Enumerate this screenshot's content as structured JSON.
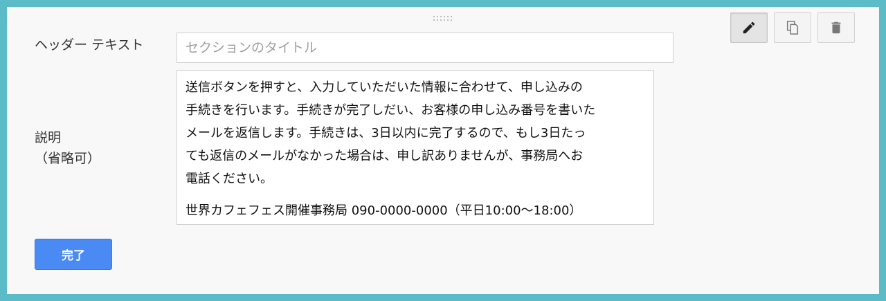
{
  "toolbar": {
    "edit_icon": "pencil-icon",
    "copy_icon": "copy-icon",
    "delete_icon": "trash-icon"
  },
  "header_text": {
    "label": "ヘッダー テキスト",
    "value": "",
    "placeholder": "セクションのタイトル"
  },
  "description": {
    "label_line1": "説明",
    "label_line2": "（省略可）",
    "lines": [
      "送信ボタンを押すと、入力していただいた情報に合わせて、申し込みの",
      "手続きを行います。手続きが完了しだい、お客様の申し込み番号を書いた",
      "メールを返信します。手続きは、3日以内に完了するので、もし3日たっ",
      "ても返信のメールがなかった場合は、申し訳ありませんが、事務局へお",
      "電話ください。"
    ],
    "contact": "世界カフェフェス開催事務局 090-0000-0000（平日10:00〜18:00）"
  },
  "done_button": {
    "label": "完了"
  },
  "colors": {
    "frame": "#5bbcc8",
    "card": "#f8f8f8",
    "primary": "#4a8af4"
  }
}
